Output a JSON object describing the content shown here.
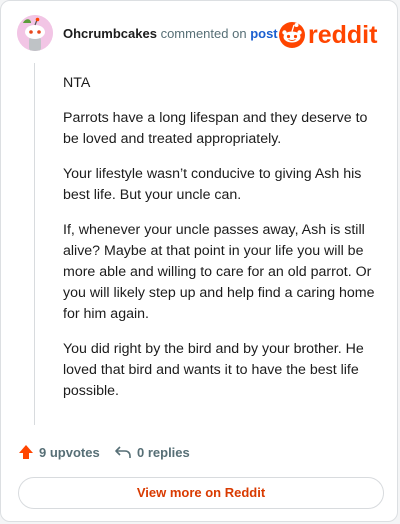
{
  "header": {
    "author": "Ohcrumbcakes",
    "action_text": "commented on",
    "post_link": "post",
    "brand": "reddit"
  },
  "comment": {
    "paragraphs": [
      "NTA",
      "Parrots have a long lifespan and they deserve to be loved and treated appropriately.",
      "Your lifestyle wasn’t conducive to giving Ash his best life. But your uncle can.",
      "If, whenever your uncle passes away, Ash is still alive? Maybe at that point in your life you will be more able and willing to care for an old parrot. Or you will likely step up and help find a caring home for him again.",
      "You did right by the bird and by your brother. He loved that bird and wants it to have the best life possible."
    ]
  },
  "actions": {
    "upvotes_label": "9 upvotes",
    "replies_label": "0 replies"
  },
  "footer": {
    "view_more_label": "View more on Reddit"
  },
  "colors": {
    "brand": "#ff4500",
    "link": "#1a5fd0",
    "view_more": "#d93a00",
    "avatar_bg": "#f2c5e5"
  },
  "icons": [
    "avatar-snoo-icon",
    "reddit-logo-icon",
    "upvote-arrow-icon",
    "reply-arrow-icon"
  ]
}
